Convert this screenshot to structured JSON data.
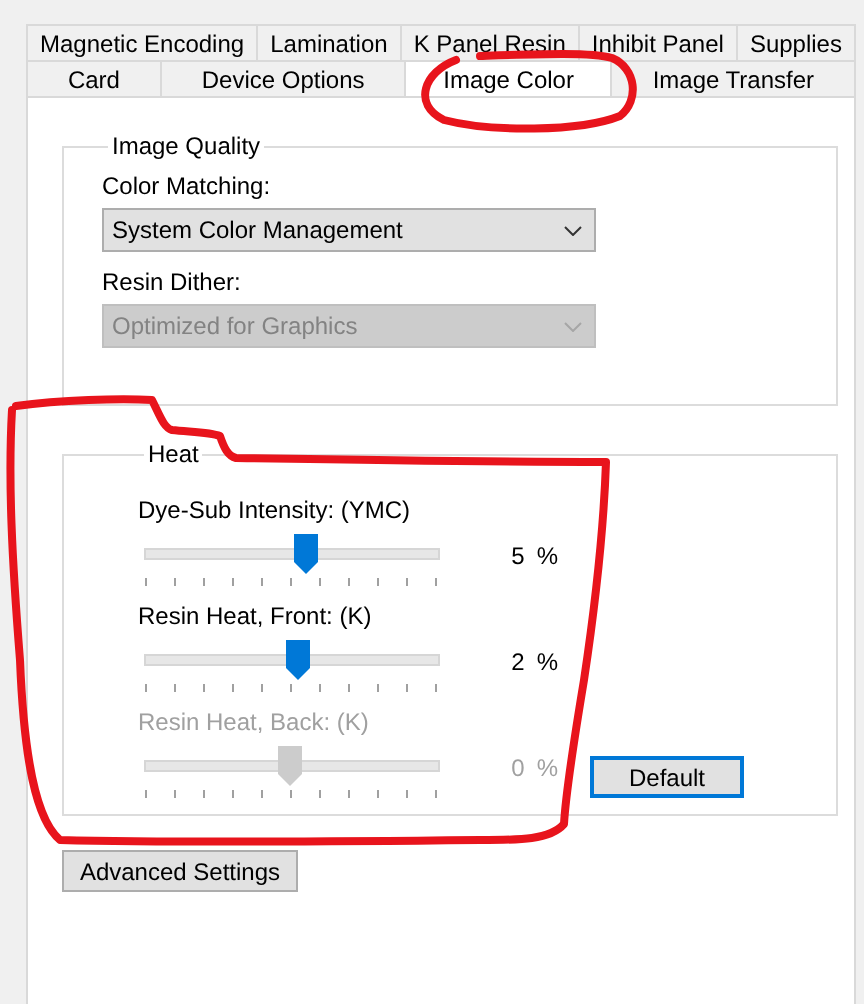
{
  "tabs": {
    "rows": [
      [
        {
          "label": "Magnetic Encoding",
          "selected": false
        },
        {
          "label": "Lamination",
          "selected": false
        },
        {
          "label": "K Panel Resin",
          "selected": false
        },
        {
          "label": "Inhibit Panel",
          "selected": false
        },
        {
          "label": "Supplies",
          "selected": false
        }
      ],
      [
        {
          "label": "Card",
          "selected": false
        },
        {
          "label": "Device Options",
          "selected": false
        },
        {
          "label": "Image Color",
          "selected": true,
          "circled": true
        },
        {
          "label": "Image Transfer",
          "selected": false
        }
      ]
    ]
  },
  "image_quality": {
    "title": "Image Quality",
    "fields": [
      {
        "label": "Color Matching:",
        "value": "System Color Management",
        "disabled": false
      },
      {
        "label": "Resin Dither:",
        "value": "Optimized for Graphics",
        "disabled": true
      }
    ]
  },
  "heat": {
    "title": "Heat",
    "sliders": [
      {
        "label": "Dye-Sub Intensity: (YMC)",
        "level": 0.55,
        "reading": "5",
        "unit": "%",
        "disabled": false
      },
      {
        "label": "Resin Heat, Front: (K)",
        "level": 0.52,
        "reading": "2",
        "unit": "%",
        "disabled": false
      },
      {
        "label": "Resin Heat, Back: (K)",
        "level": 0.49,
        "reading": "0",
        "unit": "%",
        "disabled": true
      }
    ],
    "default_button": {
      "label": "Default",
      "focused": true
    },
    "outlined": true
  },
  "advanced_button": {
    "label": "Advanced Settings"
  }
}
